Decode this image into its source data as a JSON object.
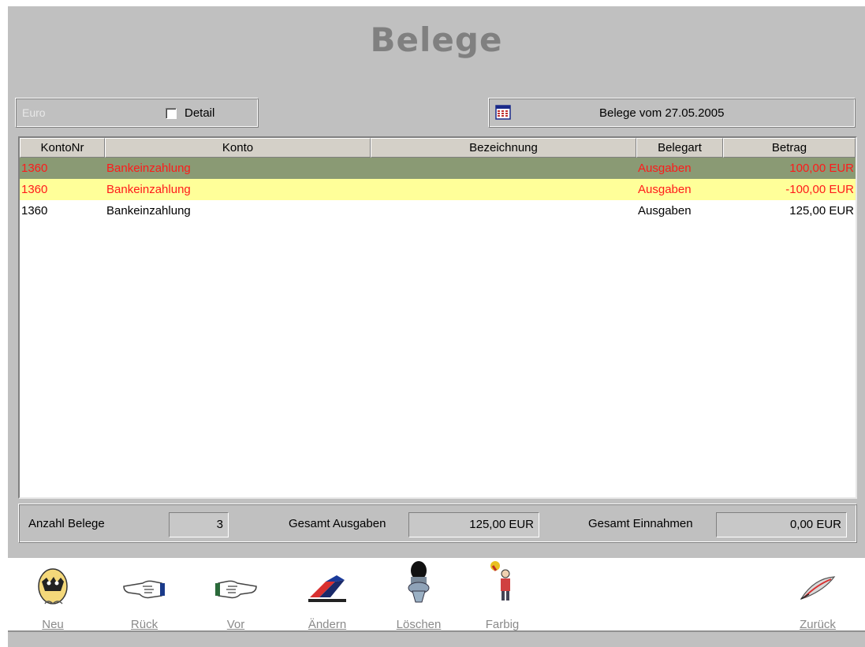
{
  "window": {
    "title": "Belege"
  },
  "filter": {
    "currency_label": "Euro",
    "detail_label": "Detail",
    "detail_checked": false,
    "date_label": "Belege vom 27.05.2005"
  },
  "table": {
    "columns": [
      "KontoNr",
      "Konto",
      "Bezeichnung",
      "Belegart",
      "Betrag"
    ],
    "rows": [
      {
        "kontonr": "1360",
        "konto": "Bankeinzahlung",
        "bezeichnung": "",
        "belegart": "Ausgaben",
        "betrag": "100,00 EUR",
        "style": "selected-green"
      },
      {
        "kontonr": "1360",
        "konto": "Bankeinzahlung",
        "bezeichnung": "",
        "belegart": "Ausgaben",
        "betrag": "-100,00 EUR",
        "style": "highlight-yellow"
      },
      {
        "kontonr": "1360",
        "konto": "Bankeinzahlung",
        "bezeichnung": "",
        "belegart": "Ausgaben",
        "betrag": "125,00 EUR",
        "style": "normal"
      }
    ]
  },
  "summary": {
    "count_label": "Anzahl Belege",
    "count_value": "3",
    "ausgaben_label": "Gesamt Ausgaben",
    "ausgaben_value": "125,00 EUR",
    "einnahmen_label": "Gesamt Einnahmen",
    "einnahmen_value": "0,00 EUR"
  },
  "toolbar": {
    "neu": "Neu",
    "rueck": "Rück",
    "vor": "Vor",
    "aendern": "Ändern",
    "loeschen": "Löschen",
    "farbig": "Farbig",
    "zurueck": "Zurück"
  },
  "colors": {
    "window_bg": "#c0c0c0",
    "title_text": "#808080",
    "row_selected_bg": "#8a9a74",
    "row_highlight_bg": "#ffff99",
    "row_alert_text": "#ff1a1a"
  },
  "icons": {
    "neu": "egg-hatching-icon",
    "rueck": "pointing-hand-left-icon",
    "vor": "pointing-hand-right-icon",
    "aendern": "eraser-icon",
    "loeschen": "toilet-icon",
    "farbig": "paint-figure-icon",
    "zurueck": "feather-quill-icon",
    "calendar": "calendar-icon"
  }
}
